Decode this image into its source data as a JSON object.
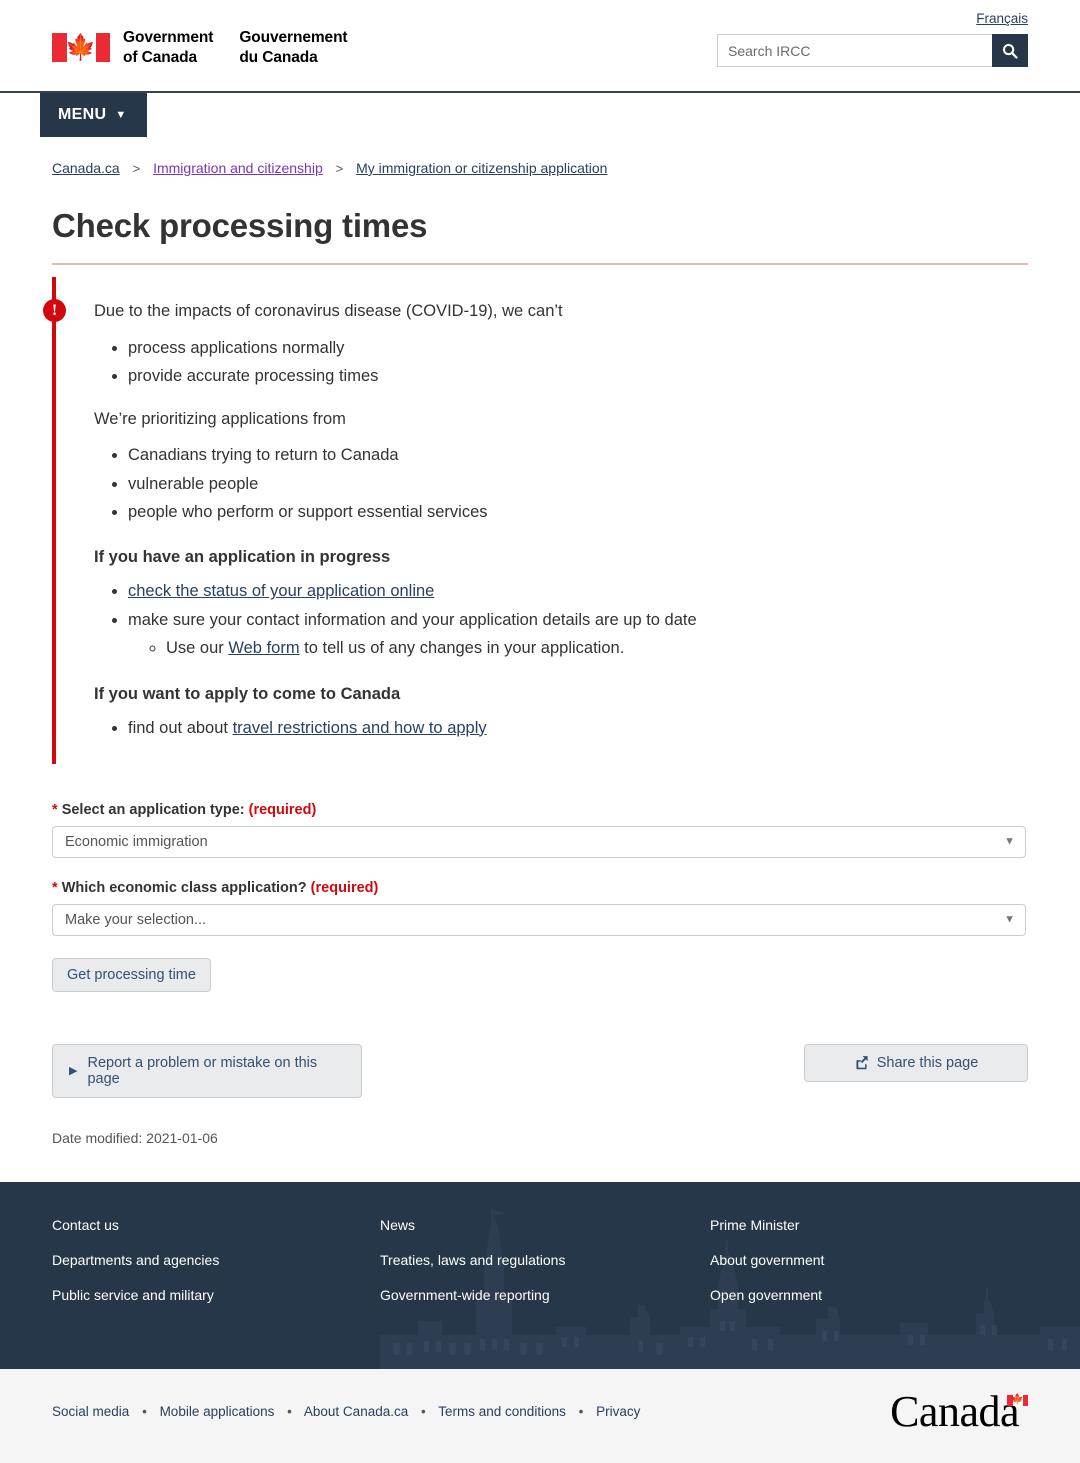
{
  "header": {
    "lang_toggle": "Français",
    "fip_en_line1": "Government",
    "fip_en_line2": "of Canada",
    "fip_fr_line1": "Gouvernement",
    "fip_fr_line2": "du Canada",
    "search_placeholder": "Search IRCC",
    "search_value": "",
    "search_icon": "search-icon",
    "menu_label": "MENU",
    "menu_caret_icon": "chevron-down-icon"
  },
  "breadcrumb": {
    "items": [
      {
        "label": "Canada.ca",
        "state": "default"
      },
      {
        "label": "Immigration and citizenship",
        "state": "visited"
      },
      {
        "label": "My immigration or citizenship application",
        "state": "default"
      }
    ],
    "separator": ">"
  },
  "main": {
    "title": "Check processing times",
    "alert": {
      "icon": "exclamation-icon",
      "intro": "Due to the impacts of coronavirus disease (COVID-19), we can’t",
      "cant_items": [
        "process applications normally",
        "provide accurate processing times"
      ],
      "prioritizing_lead": "We’re prioritizing applications from",
      "prioritizing_items": [
        "Canadians trying to return to Canada",
        "vulnerable people",
        "people who perform or support essential services"
      ],
      "in_progress_heading": "If you have an application in progress",
      "in_progress_link": "check the status of your application online",
      "in_progress_item2": "make sure your contact information and your application details are up to date",
      "in_progress_sub_prefix": "Use our ",
      "in_progress_sub_link": "Web form",
      "in_progress_sub_suffix": " to tell us of any changes in your application.",
      "apply_heading": "If you want to apply to come to Canada",
      "apply_prefix": "find out about ",
      "apply_link": "travel restrictions and how to apply"
    },
    "form": {
      "field1_label": "Select an application type:",
      "field1_required": "(required)",
      "field1_value": "Economic immigration",
      "field1_options": [
        "Economic immigration"
      ],
      "field2_label": "Which economic class application?",
      "field2_required": "(required)",
      "field2_value": "Make your selection...",
      "field2_options": [
        "Make your selection..."
      ],
      "required_star": "*",
      "submit_label": "Get processing time",
      "caret_icon": "chevron-down-icon"
    },
    "report_button": {
      "label": "Report a problem or mistake on this page",
      "icon": "triangle-right-icon"
    },
    "share_button": {
      "label": "Share this page",
      "icon": "share-icon"
    },
    "date_modified": "Date modified: 2021-01-06"
  },
  "footer": {
    "columns": [
      [
        "Contact us",
        "Departments and agencies",
        "Public service and military"
      ],
      [
        "News",
        "Treaties, laws and regulations",
        "Government-wide reporting"
      ],
      [
        "Prime Minister",
        "About government",
        "Open government"
      ]
    ],
    "sub_links": [
      "Social media",
      "Mobile applications",
      "About Canada.ca",
      "Terms and conditions",
      "Privacy"
    ],
    "sub_separator": "•",
    "wordmark": "Canada",
    "wordmark_flag_icon": "canada-flag-icon"
  },
  "colors": {
    "brand_navy": "#26374A",
    "alert_red": "#d3080c",
    "link_blue": "#284162",
    "link_visited": "#7834bc",
    "flag_red": "#EA2B35",
    "button_grey": "#eaebed"
  }
}
